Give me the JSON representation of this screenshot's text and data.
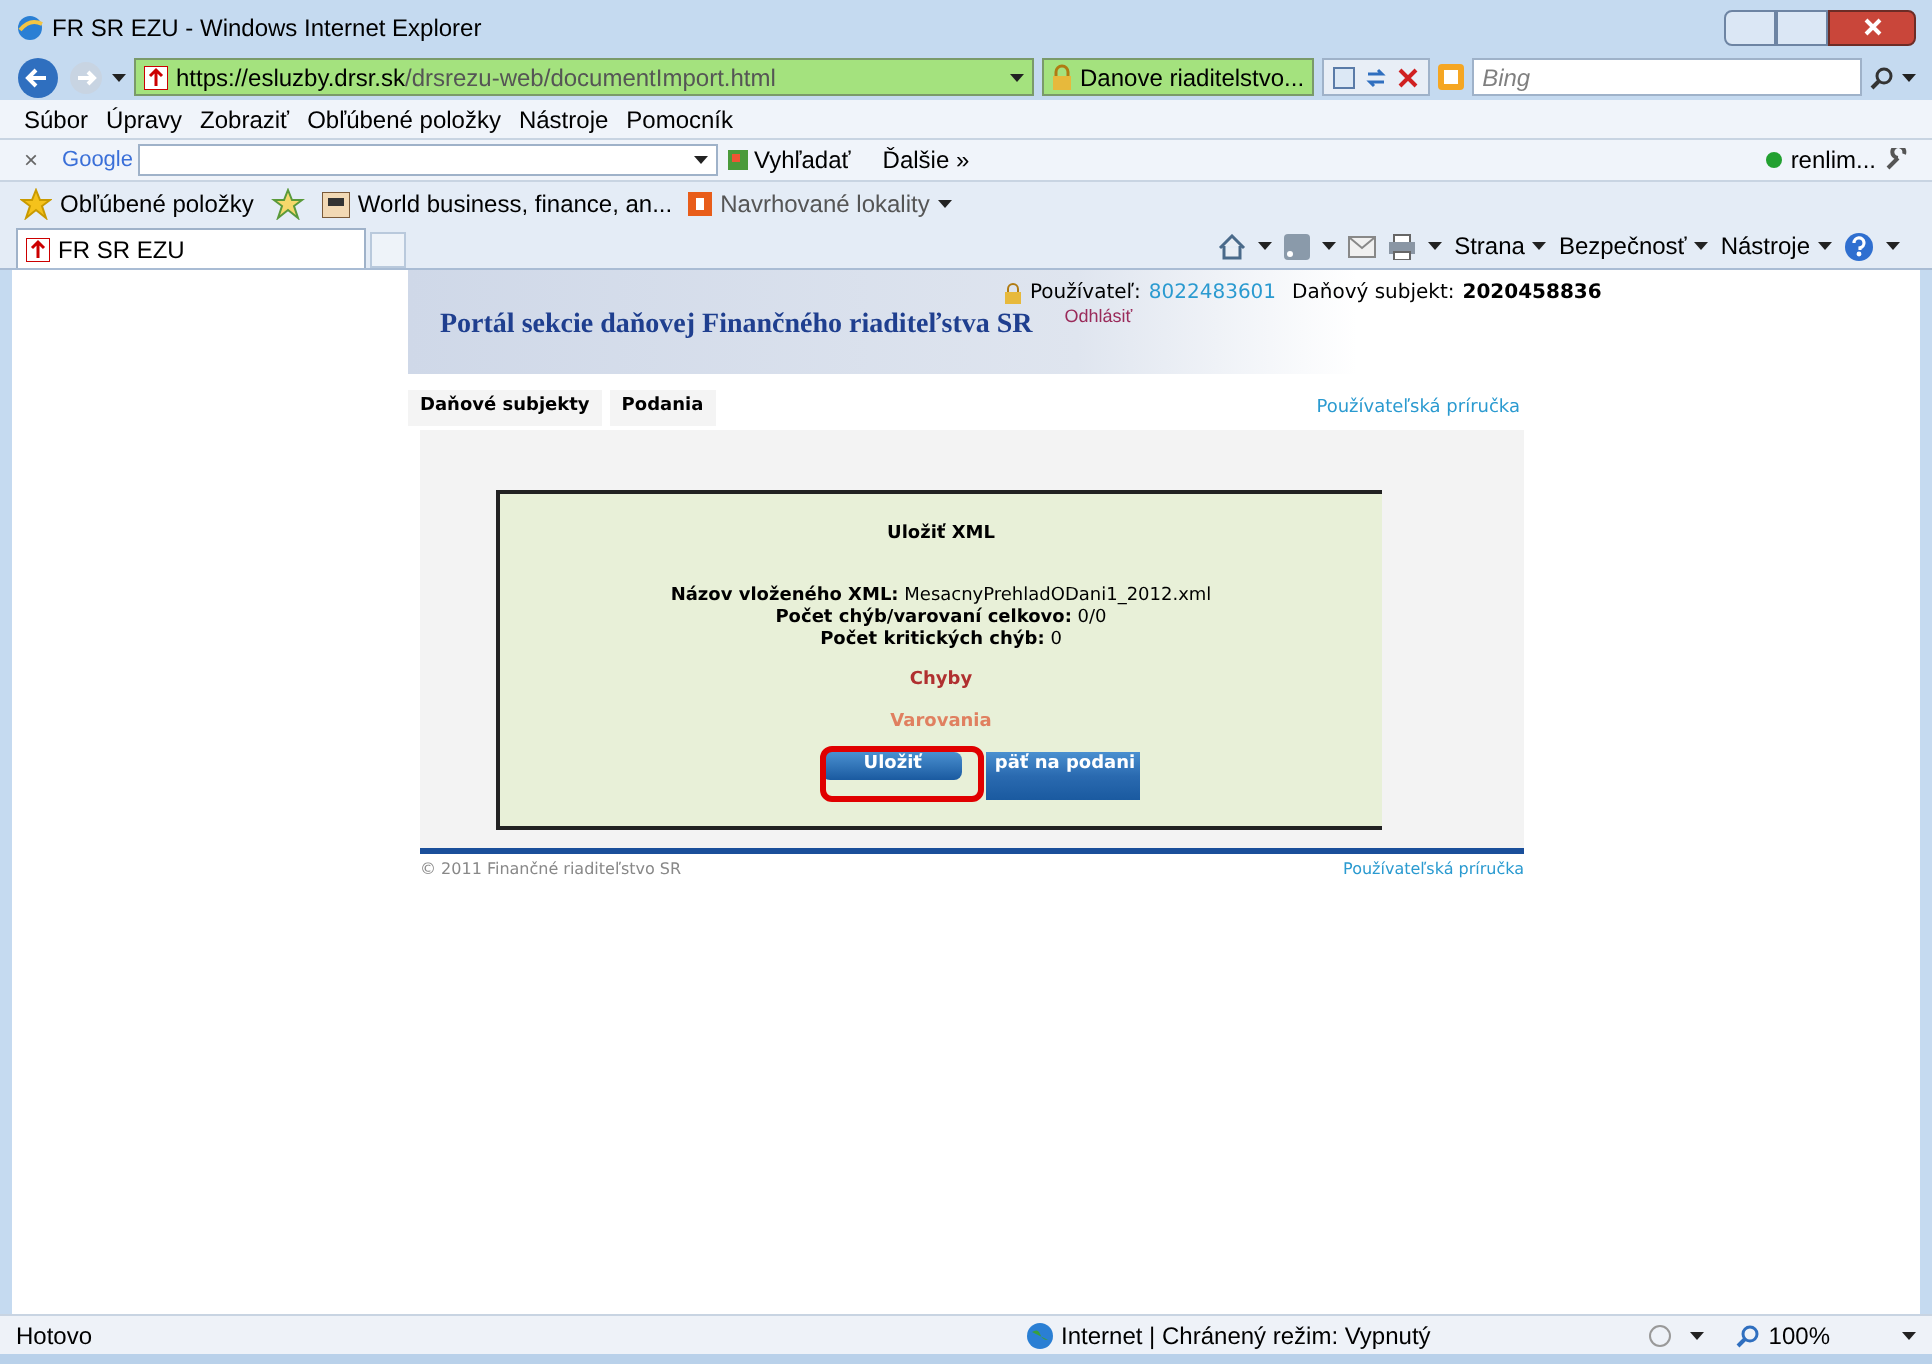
{
  "window": {
    "title": "FR SR EZU - Windows Internet Explorer"
  },
  "address": {
    "url_prefix": "https://",
    "url_host": "esluzby.drsr.sk",
    "url_path": "/drsrezu-web/documentImport.html",
    "certificate": "Danove riaditelstvo...",
    "search_placeholder": "Bing"
  },
  "menu": [
    "Súbor",
    "Úpravy",
    "Zobraziť",
    "Obľúbené položky",
    "Nástroje",
    "Pomocník"
  ],
  "google_toolbar": {
    "close": "×",
    "logo": "Google",
    "search_button": "Vyhľadať",
    "more": "Ďalšie",
    "more_arrows": "»",
    "user": "renlim..."
  },
  "favorites_bar": {
    "favorites": "Obľúbené položky",
    "links": [
      "World business, finance, an...",
      "Navrhované lokality"
    ]
  },
  "tabs": [
    {
      "label": "FR SR EZU",
      "selected": true
    }
  ],
  "command_bar": [
    "Strana",
    "Bezpečnosť",
    "Nástroje"
  ],
  "page": {
    "header": {
      "title": "Portál sekcie daňovej Finančného riaditeľstva SR",
      "user_label": "Používateľ:",
      "user_id": "8022483601",
      "subject_label": "Daňový subjekt:",
      "subject_id": "2020458836",
      "logout": "Odhlásiť"
    },
    "nav": [
      {
        "label": "Daňové subjekty"
      },
      {
        "label": "Podania"
      }
    ],
    "help_link": "Používateľská príručka",
    "dialog": {
      "title": "Uložiť XML",
      "info": [
        {
          "label": "Názov vloženého XML:",
          "value": "MesacnyPrehladODani1_2012.xml"
        },
        {
          "label": "Počet chýb/varovaní celkovo:",
          "value": "0/0"
        },
        {
          "label": "Počet kritických chýb:",
          "value": "0"
        }
      ],
      "errors": "Chyby",
      "warnings": "Varovania",
      "buttons": [
        "Uložiť",
        "päť na podani"
      ]
    },
    "footer": {
      "copyright": "© 2011 Finančné riaditeľstvo SR",
      "help_link": "Používateľská príručka"
    }
  },
  "status_bar": {
    "status": "Hotovo",
    "zone": "Internet | Chránený režim: Vypnutý",
    "zoom": "100%"
  }
}
